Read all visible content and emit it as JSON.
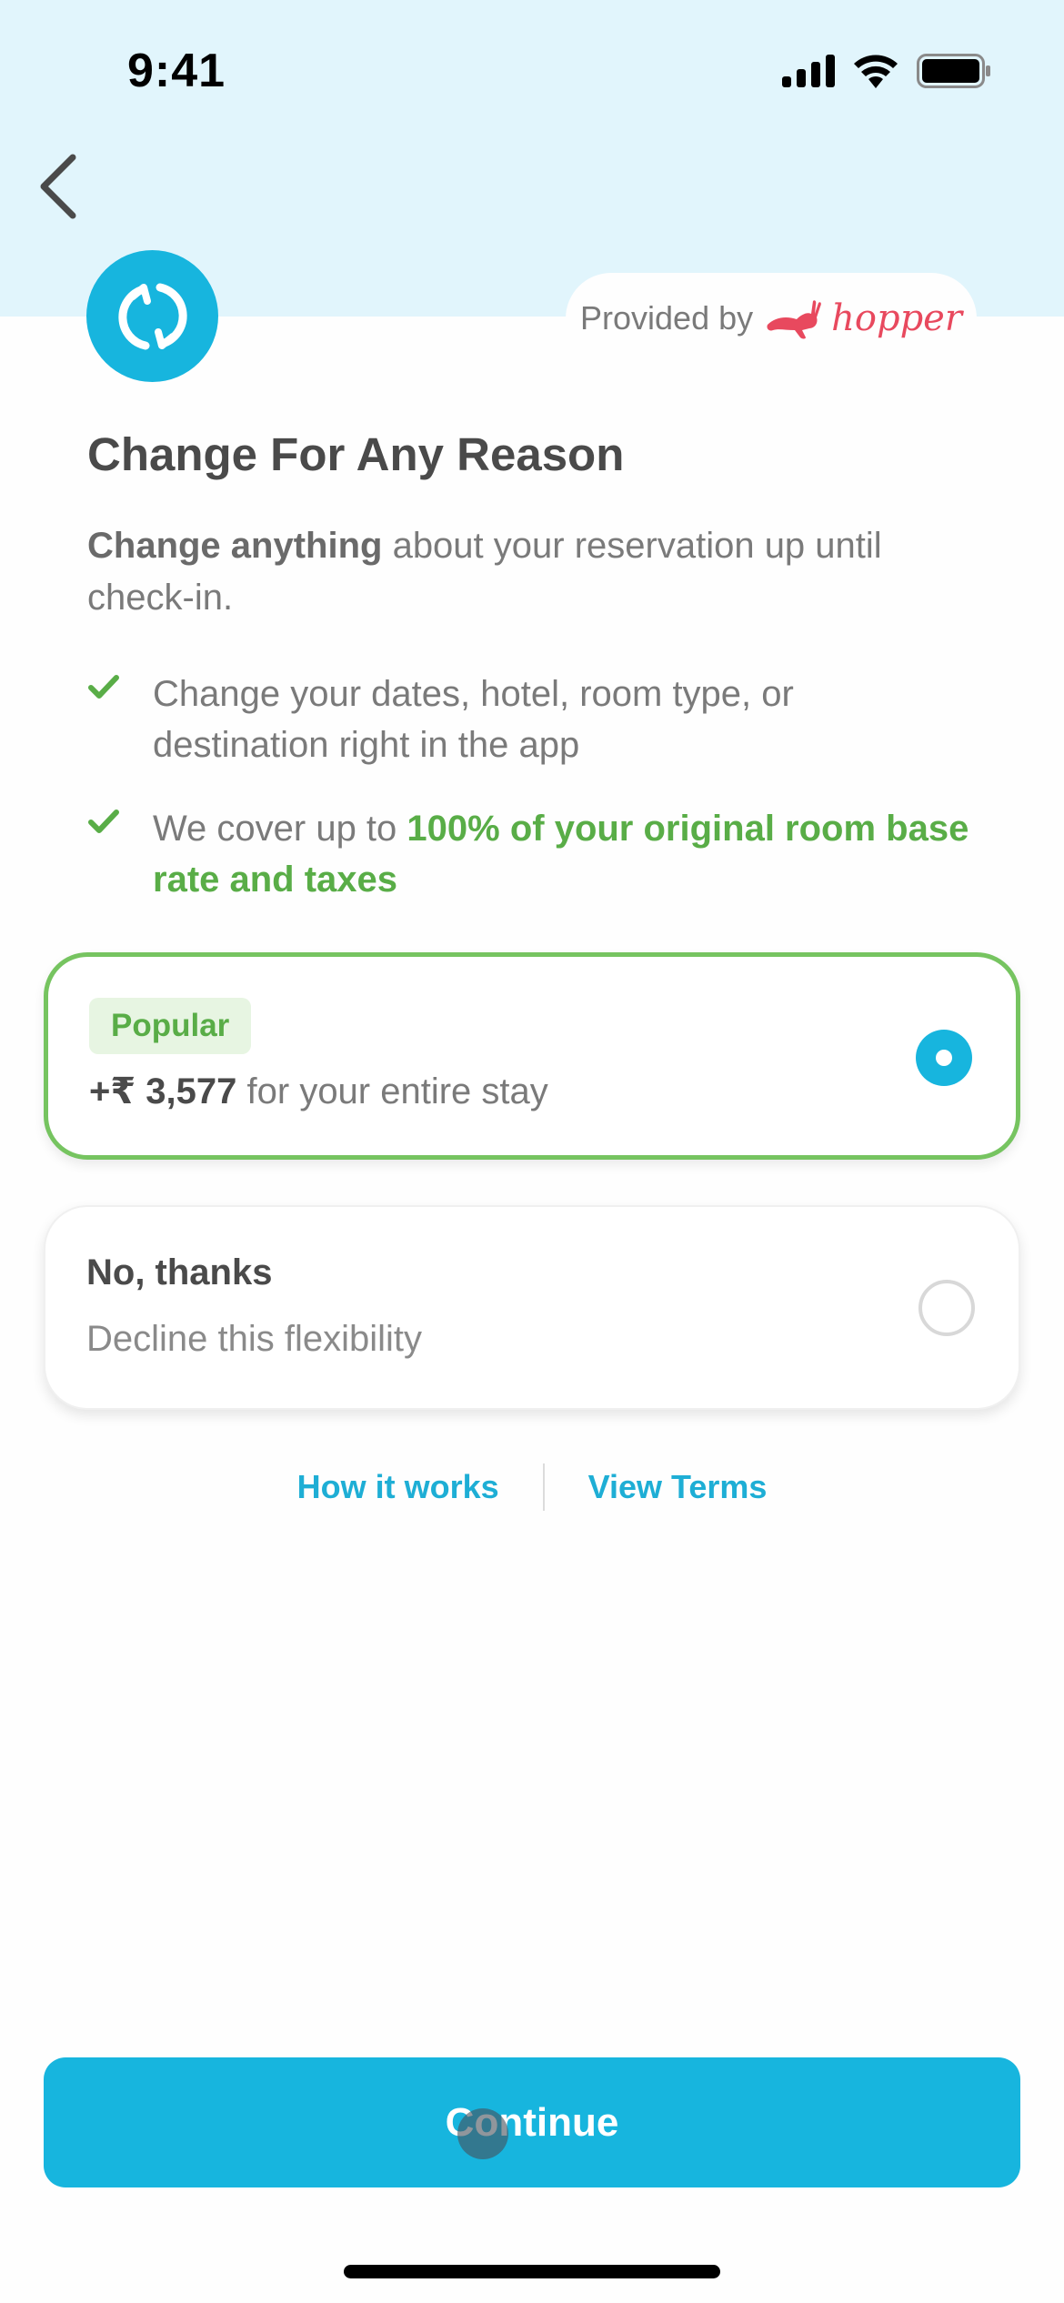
{
  "status_bar": {
    "time": "9:41",
    "icons": [
      "cellular-signal-icon",
      "wifi-icon",
      "battery-icon"
    ]
  },
  "nav": {
    "back_icon": "chevron-left-icon"
  },
  "brand": {
    "icon": "refresh-cycle-icon",
    "provided_by_label": "Provided by",
    "partner_name": "hopper",
    "partner_logo_icon": "hopper-rabbit-icon"
  },
  "content": {
    "title": "Change For Any Reason",
    "description_bold": "Change anything",
    "description_rest": " about your reservation up until check-in.",
    "bullets": [
      {
        "icon": "check-icon",
        "text": "Change your dates, hotel, room type, or destination right in the app",
        "highlight": ""
      },
      {
        "icon": "check-icon",
        "text": "We cover up to ",
        "highlight": "100% of your original room base rate and taxes"
      }
    ]
  },
  "options": [
    {
      "badge": "Popular",
      "price": "+₹ 3,577",
      "price_suffix": " for your entire stay",
      "selected": true
    },
    {
      "title": "No, thanks",
      "subtitle": "Decline this flexibility",
      "selected": false
    }
  ],
  "links": {
    "how_it_works": "How it works",
    "view_terms": "View Terms"
  },
  "footer": {
    "continue_label": "Continue"
  },
  "colors": {
    "accent": "#17b5de",
    "success": "#59ad47",
    "selected_border": "#76c460",
    "header_bg": "#e1f5fc",
    "hopper_red": "#e8495e"
  }
}
